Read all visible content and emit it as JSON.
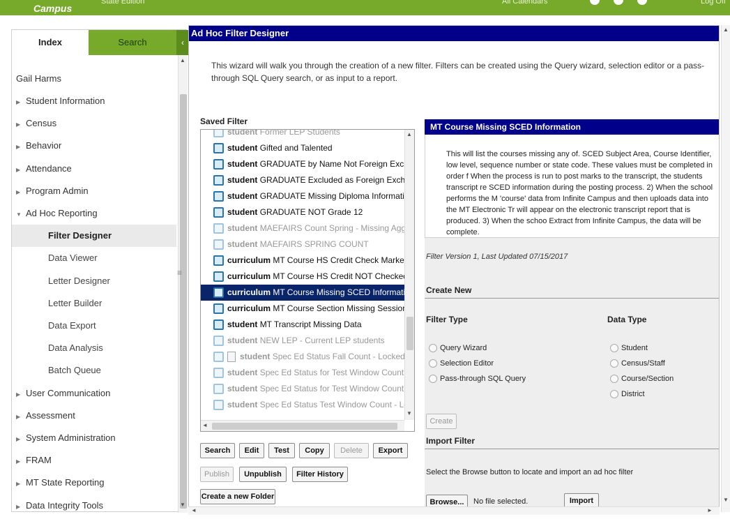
{
  "topbar": {
    "logo": "Campus",
    "edition": "State Edition",
    "calendar": "All Calendars",
    "logoff": "Log Off"
  },
  "sidebar": {
    "tabs": {
      "index": "Index",
      "search": "Search"
    },
    "collapse_glyph": "‹",
    "user": "Gail Harms",
    "items": [
      {
        "label": "Student Information",
        "type": "top"
      },
      {
        "label": "Census",
        "type": "top"
      },
      {
        "label": "Behavior",
        "type": "top"
      },
      {
        "label": "Attendance",
        "type": "top"
      },
      {
        "label": "Program Admin",
        "type": "top"
      },
      {
        "label": "Ad Hoc Reporting",
        "type": "top-open"
      },
      {
        "label": "Filter Designer",
        "type": "sub-selected"
      },
      {
        "label": "Data Viewer",
        "type": "sub"
      },
      {
        "label": "Letter Designer",
        "type": "sub"
      },
      {
        "label": "Letter Builder",
        "type": "sub"
      },
      {
        "label": "Data Export",
        "type": "sub"
      },
      {
        "label": "Data Analysis",
        "type": "sub"
      },
      {
        "label": "Batch Queue",
        "type": "sub"
      },
      {
        "label": "User Communication",
        "type": "top"
      },
      {
        "label": "Assessment",
        "type": "top"
      },
      {
        "label": "System Administration",
        "type": "top"
      },
      {
        "label": "FRAM",
        "type": "top"
      },
      {
        "label": "MT State Reporting",
        "type": "top"
      },
      {
        "label": "Data Integrity Tools",
        "type": "top"
      }
    ]
  },
  "main": {
    "title": "Ad Hoc Filter Designer",
    "intro": "This wizard will walk you through the creation of a new filter. Filters can be created using the Query wizard, selection editor or a pass-through SQL Query search, or as input to a report.",
    "saved_filter_label": "Saved Filter",
    "filters": [
      {
        "type": "student",
        "name": "Former LEP Students",
        "dim": true,
        "partial": true
      },
      {
        "type": "student",
        "name": "Gifted and Talented",
        "dim": false
      },
      {
        "type": "student",
        "name": "GRADUATE by Name Not Foreign Exchang",
        "dim": false
      },
      {
        "type": "student",
        "name": "GRADUATE Excluded as Foreign Exchang",
        "dim": false
      },
      {
        "type": "student",
        "name": "GRADUATE Missing Diploma Information",
        "dim": false
      },
      {
        "type": "student",
        "name": "GRADUATE NOT Grade 12",
        "dim": false
      },
      {
        "type": "student",
        "name": "MAEFAIRS Count Spring - Missing Agg hou",
        "dim": true
      },
      {
        "type": "student",
        "name": "MAEFAIRS SPRING COUNT",
        "dim": true
      },
      {
        "type": "curriculum",
        "name": "MT Course HS Credit Check Marked for",
        "dim": false
      },
      {
        "type": "curriculum",
        "name": "MT Course HS Credit NOT Checked for",
        "dim": false
      },
      {
        "type": "curriculum",
        "name": "MT Course Missing SCED Information",
        "dim": false,
        "selected": true
      },
      {
        "type": "curriculum",
        "name": "MT Course Section Missing Session inf",
        "dim": false
      },
      {
        "type": "student",
        "name": "MT Transcript Missing Data",
        "dim": false
      },
      {
        "type": "student",
        "name": "NEW LEP - Current LEP students",
        "dim": true
      },
      {
        "type": "student",
        "name": "Spec Ed Status Fall Count - Locked",
        "dim": true,
        "doc": true
      },
      {
        "type": "student",
        "name": "Spec Ed Status for Test Window Count - Lo",
        "dim": true
      },
      {
        "type": "student",
        "name": "Spec Ed Status for Test Window Count - Ul",
        "dim": true
      },
      {
        "type": "student",
        "name": "Spec Ed Status Test Window Count - Lock",
        "dim": true
      }
    ],
    "buttons": {
      "search": "Search",
      "edit": "Edit",
      "test": "Test",
      "copy": "Copy",
      "delete": "Delete",
      "export": "Export",
      "publish": "Publish",
      "unpublish": "Unpublish",
      "filter_history": "Filter History",
      "create_folder": "Create a new Folder"
    },
    "detail": {
      "title": "MT Course Missing SCED Information",
      "description": "This will list the courses missing any of. SCED Subject Area, Course Identifier, low level, sequence number or state code. These values must be completed in order f When the process is run to post marks to the transcript, the students transcript re SCED information during the posting process. 2) When the school performs the M 'course' data from Infinite Campus and then uploads data into the MT Electronic Tr will appear on the electronic transcript report that is produced. 3) When the schoo Extract from Infinite Campus, the data will be complete.",
      "version": "Filter Version 1,   Last Updated 07/15/2017"
    },
    "create_new": {
      "heading": "Create New",
      "filter_type_heading": "Filter Type",
      "data_type_heading": "Data Type",
      "filter_types": [
        "Query Wizard",
        "Selection Editor",
        "Pass-through SQL Query"
      ],
      "data_types": [
        "Student",
        "Census/Staff",
        "Course/Section",
        "District"
      ],
      "create_button": "Create"
    },
    "import_filter": {
      "heading": "Import Filter",
      "instruction": "Select the Browse button to locate and import an ad hoc filter",
      "browse_button": "Browse...",
      "no_file": "No file selected.",
      "import_button": "Import"
    }
  }
}
